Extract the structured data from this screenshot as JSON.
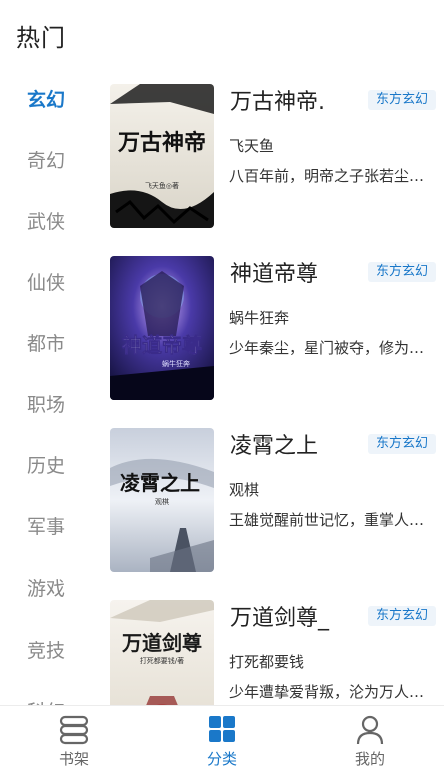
{
  "header": {
    "title": "热门"
  },
  "sidebar": {
    "items": [
      {
        "label": "玄幻",
        "active": true
      },
      {
        "label": "奇幻"
      },
      {
        "label": "武侠"
      },
      {
        "label": "仙侠"
      },
      {
        "label": "都市"
      },
      {
        "label": "职场"
      },
      {
        "label": "历史"
      },
      {
        "label": "军事"
      },
      {
        "label": "游戏"
      },
      {
        "label": "竞技"
      },
      {
        "label": "科幻"
      }
    ]
  },
  "books": [
    {
      "title": "万古神帝.",
      "tag": "东方玄幻",
      "author": "飞天鱼",
      "description": "八百年前，明帝之子张若尘…",
      "cover_text": "万古神帝",
      "cover_caption": "飞天鱼◎著"
    },
    {
      "title": "神道帝尊",
      "tag": "东方玄幻",
      "author": "蜗牛狂奔",
      "description": "少年秦尘，星门被夺，修为…",
      "cover_text": "神道帝尊",
      "cover_caption": "蜗牛狂奔"
    },
    {
      "title": "凌霄之上",
      "tag": "东方玄幻",
      "author": "观棋",
      "description": "王雄觉醒前世记忆，重掌人…",
      "cover_text": "凌霄之上",
      "cover_caption": "观棋"
    },
    {
      "title": "万道剑尊_",
      "tag": "东方玄幻",
      "author": "打死都要钱",
      "description": "少年遭挚爱背叛，沦为万人…",
      "cover_text": "万道剑尊",
      "cover_caption": "打死都要钱/著"
    }
  ],
  "tabbar": {
    "tabs": [
      {
        "label": "书架",
        "icon": "bookshelf-icon"
      },
      {
        "label": "分类",
        "icon": "category-grid-icon",
        "active": true
      },
      {
        "label": "我的",
        "icon": "user-icon"
      }
    ]
  },
  "colors": {
    "accent": "#1a78c9",
    "tag_bg": "#eef4fa",
    "muted": "#8a8a8a"
  }
}
